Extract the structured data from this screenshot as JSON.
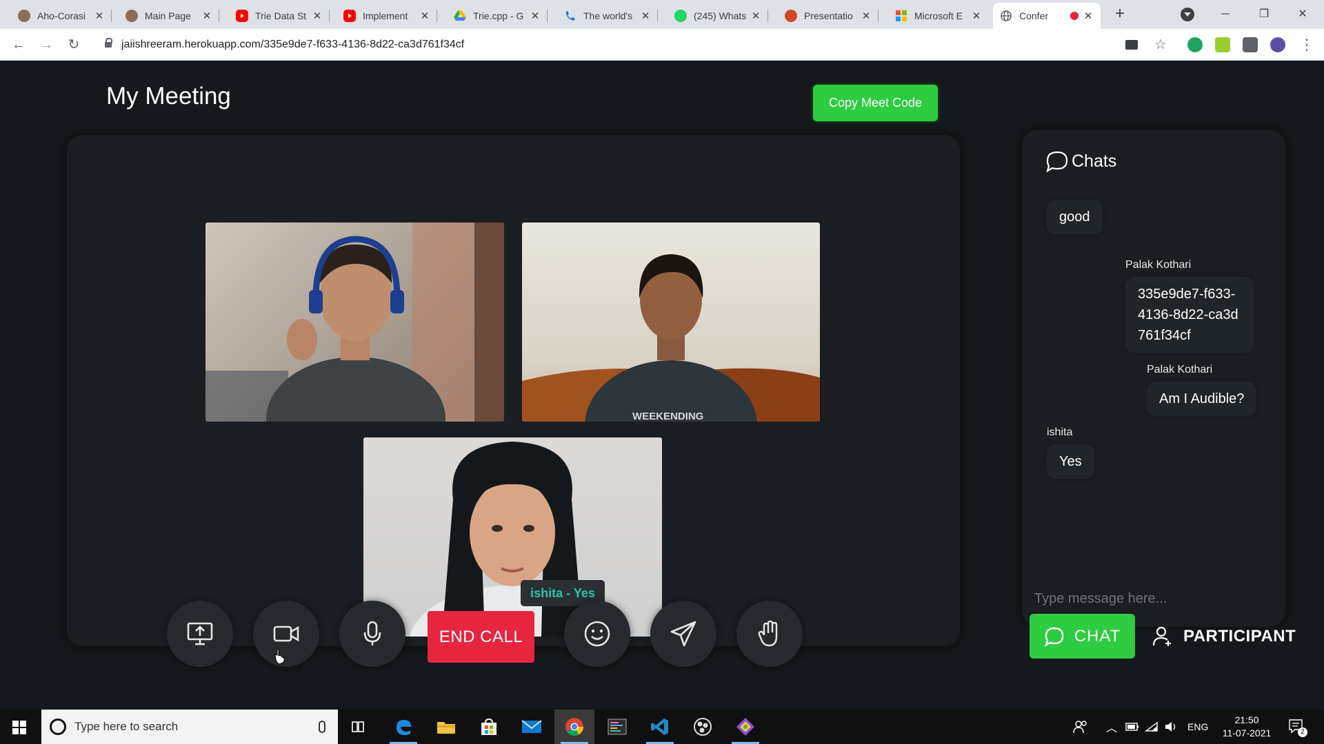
{
  "browser": {
    "tabs": [
      {
        "title": "Aho-Corasi",
        "icon": "avatar-favicon",
        "color": "#8a6d5a"
      },
      {
        "title": "Main Page",
        "icon": "avatar-favicon",
        "color": "#8a6d5a"
      },
      {
        "title": "Trie Data St",
        "icon": "youtube-favicon",
        "color": "#ff0000"
      },
      {
        "title": "Implement",
        "icon": "youtube-favicon",
        "color": "#ff0000"
      },
      {
        "title": "Trie.cpp - G",
        "icon": "drive-favicon",
        "color": "#34a853"
      },
      {
        "title": "The world's",
        "icon": "phone-favicon",
        "color": "#1a73e8"
      },
      {
        "title": "(245) Whats",
        "icon": "whatsapp-favicon",
        "color": "#25d366"
      },
      {
        "title": "Presentatio",
        "icon": "powerpoint-favicon",
        "color": "#d24726"
      },
      {
        "title": "Microsoft E",
        "icon": "microsoft-favicon",
        "color": "#f25022"
      },
      {
        "title": "Confer",
        "icon": "globe-favicon",
        "color": "#5f6368",
        "active": true,
        "recording": true
      }
    ],
    "new_tab": "+",
    "url": "jaiishreeram.herokuapp.com/335e9de7-f633-4136-8d22-ca3d761f34cf"
  },
  "meeting": {
    "title": "My Meeting",
    "copy_button": "Copy Meet Code",
    "tooltip": "ishita - Yes",
    "end_call": "END CALL"
  },
  "chat": {
    "title": "Chats",
    "messages": [
      {
        "sender": "",
        "text": "good",
        "align": "left"
      },
      {
        "sender": "Palak Kothari",
        "text": "335e9de7-f633-4136-8d22-ca3d761f34cf",
        "align": "right"
      },
      {
        "sender": "Palak Kothari",
        "text": "Am I Audible?",
        "align": "right"
      },
      {
        "sender": "ishita",
        "text": "Yes",
        "align": "left"
      }
    ],
    "input_placeholder": "Type message here...",
    "chat_button": "CHAT",
    "participant_button": "PARTICIPANT"
  },
  "taskbar": {
    "search_placeholder": "Type here to search",
    "language": "ENG",
    "time": "21:50",
    "date": "11-07-2021",
    "notification_count": "2"
  },
  "colors": {
    "accent_green": "#2ecc40",
    "end_call_red": "#e8253f",
    "tooltip_text": "#26c6a2"
  }
}
